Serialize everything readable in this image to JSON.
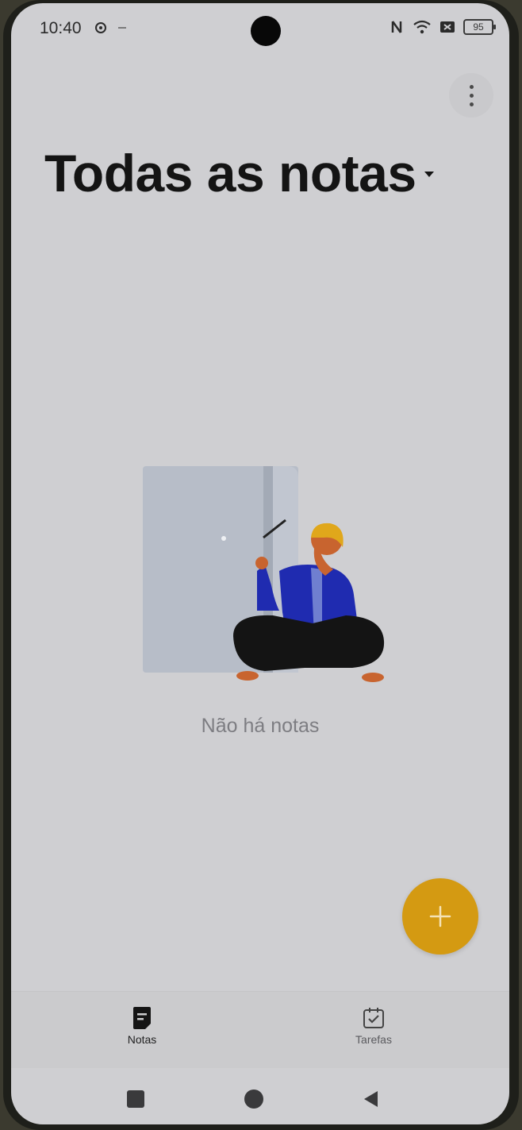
{
  "status_bar": {
    "time": "10:40",
    "battery": "95",
    "icons": [
      "settings-icon",
      "minus-icon",
      "nfc-icon",
      "wifi-icon",
      "sim-icon",
      "battery-icon"
    ]
  },
  "header": {
    "title": "Todas as notas",
    "menu_icon": "more-vertical-icon"
  },
  "empty_state": {
    "message": "Não há notas",
    "illustration": "person-sitting-with-notebook-illustration"
  },
  "fab": {
    "icon": "plus-icon"
  },
  "bottom_nav": {
    "tabs": [
      {
        "label": "Notas",
        "icon": "note-icon",
        "selected": true
      },
      {
        "label": "Tarefas",
        "icon": "task-checkbox-icon",
        "selected": false
      }
    ]
  },
  "system_nav": {
    "buttons": [
      "recents-icon",
      "home-icon",
      "back-icon"
    ]
  },
  "colors": {
    "background": "#cfcfd2",
    "accent": "#d49a12",
    "title": "#141414",
    "muted_text": "#7d7d82"
  }
}
